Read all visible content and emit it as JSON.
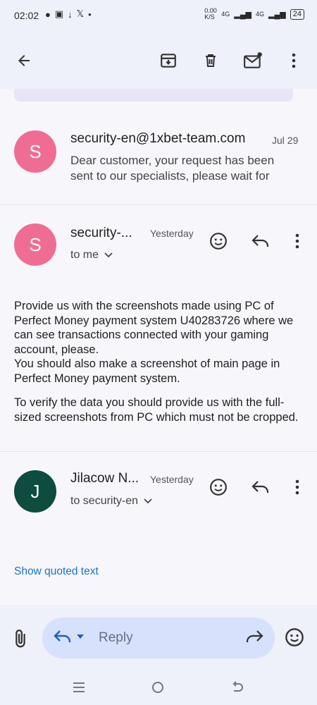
{
  "status_bar": {
    "time": "02:02",
    "net_speed": "0.00 K/S",
    "signal1": "4G",
    "signal2": "4G",
    "battery": "24"
  },
  "message1": {
    "avatar_letter": "S",
    "sender": "security-en@1xbet-team.com",
    "date": "Jul 29",
    "snippet": "Dear customer, your request has been sent to our specialists, please wait for",
    "avatar_color": "#ef6d94"
  },
  "message2": {
    "avatar_letter": "S",
    "sender": "security-...",
    "date": "Yesterday",
    "to": "to me",
    "avatar_color": "#ef6d94",
    "body": [
      "Provide us with the screenshots made using PC of Perfect Money payment system U40283726 where we can see transactions connected with your gaming account, please.",
      "You should also make a screenshot of main page in Perfect Money payment system.",
      "To verify the data you should provide us with the full-sized screenshots from PC which must not be cropped."
    ]
  },
  "message3": {
    "avatar_letter": "J",
    "sender": "Jilacow N...",
    "date": "Yesterday",
    "to": "to security-en",
    "avatar_color": "#0d4c3e",
    "show_quoted": "Show quoted text"
  },
  "compose": {
    "reply_label": "Reply"
  },
  "colors": {
    "accent": "#1a73c8",
    "toolbar_bg": "#eef0fa",
    "reply_bg": "#d7e1fb"
  },
  "icons": [
    "back-arrow-icon",
    "archive-icon",
    "delete-icon",
    "mark-unread-icon",
    "more-vert-icon",
    "emoji-icon",
    "reply-icon",
    "attach-icon",
    "forward-icon"
  ]
}
